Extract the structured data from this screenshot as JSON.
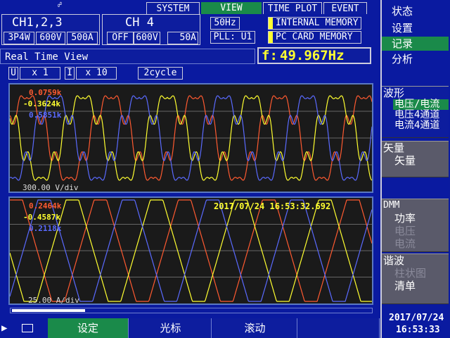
{
  "tabs": {
    "system": "SYSTEM",
    "view": "VIEW",
    "time_plot": "TIME PLOT",
    "event": "EVENT"
  },
  "ch123": {
    "title": "CH1,2,3",
    "wiring": "3P4W",
    "voltage": "600V",
    "current": "500A"
  },
  "ch4": {
    "title": "CH 4",
    "mode": "OFF",
    "voltage": "600V",
    "current": "50A"
  },
  "freq_setting": "50Hz",
  "pll": "PLL: U1",
  "memory": {
    "internal": "INTERNAL MEMORY",
    "pc_card": "PC CARD  MEMORY"
  },
  "view_title": "Real Time View",
  "frequency": {
    "label": "f:",
    "value": "49.967Hz"
  },
  "range": {
    "u_label": "U",
    "u_zoom": "x 1",
    "i_label": "I",
    "i_zoom": "x 10",
    "cycles": "2cycle"
  },
  "voltage_graph": {
    "v1": "0.0759k",
    "v2": "-0.3624k",
    "v3": "0.5851k",
    "scale": "300.00 V/div"
  },
  "current_graph": {
    "i1": "0.2464k",
    "i2": "-0.4587k",
    "i3": "0.2118k",
    "scale": "25.00 A/div",
    "timestamp": "2017/07/24  16:53:32.692"
  },
  "menu": {
    "status": "状态",
    "settings": "设置",
    "record": "记录",
    "analysis": "分析"
  },
  "waveform": {
    "title": "波形",
    "item1": "电压/电流",
    "item2": "电压4通道",
    "item3": "电流4通道"
  },
  "vector": {
    "title": "矢量",
    "item1": "矢量"
  },
  "dmm": {
    "title": "DMM",
    "item1": "功率",
    "item2": "电压",
    "item3": "电流"
  },
  "harmonic": {
    "title": "谐波",
    "item1": "柱状图",
    "item2": "清单"
  },
  "clock": {
    "date": "2017/07/24",
    "time": "16:53:33"
  },
  "fkeys": {
    "f1": "设定",
    "f2": "光标",
    "f3": "滚动",
    "f4": ""
  },
  "colors": {
    "u1": "#ff5a30",
    "u2": "#ffff30",
    "u3": "#5a6aff",
    "accent": "#1a8a4a"
  }
}
